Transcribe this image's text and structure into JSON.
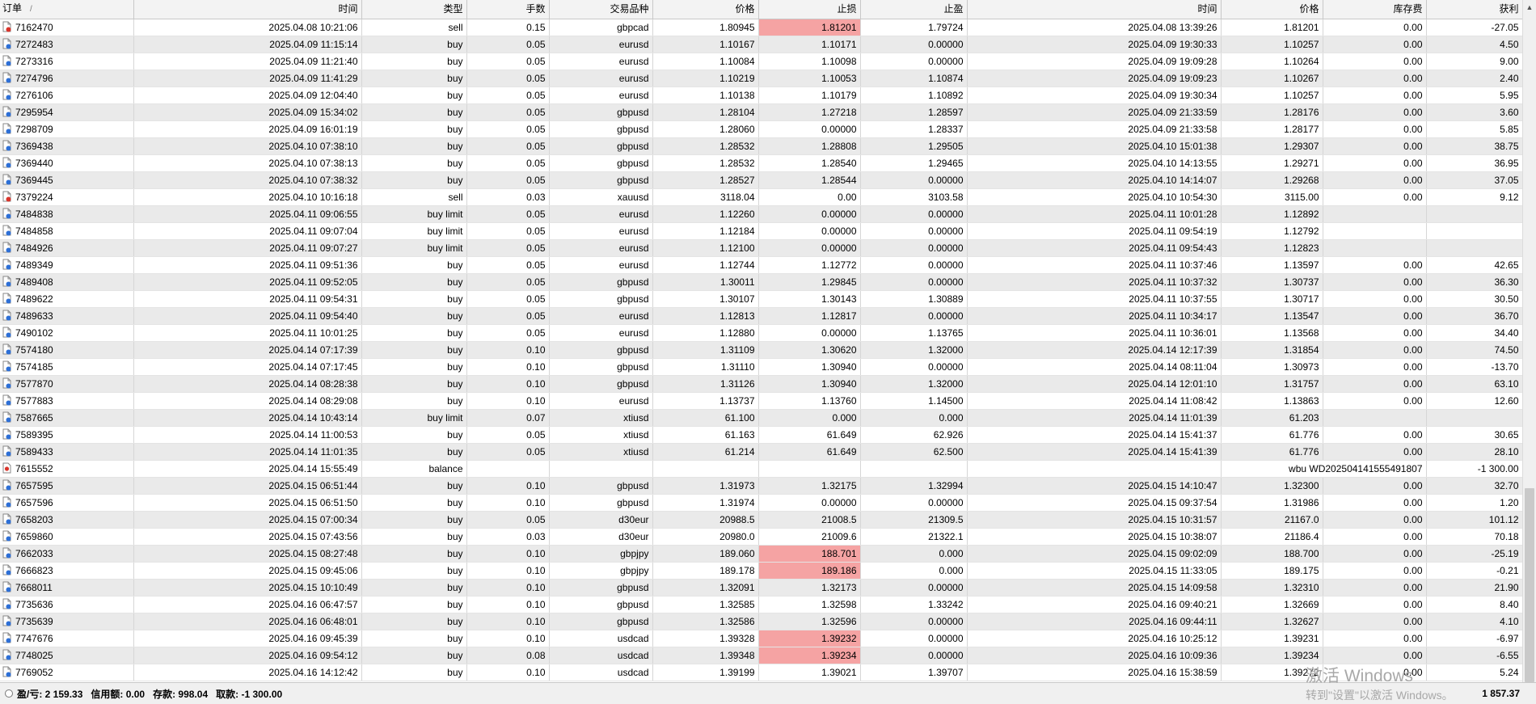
{
  "table": {
    "headers": [
      "订单",
      "时间",
      "类型",
      "手数",
      "交易品种",
      "价格",
      "止损",
      "止盈",
      "时间",
      "价格",
      "库存费",
      "获利"
    ],
    "sort_indicator": "/",
    "rows": [
      {
        "id": "7162470",
        "icon": "sell",
        "open_time": "2025.04.08 10:21:06",
        "type": "sell",
        "lots": "0.15",
        "symbol": "gbpcad",
        "price": "1.80945",
        "sl": "1.81201",
        "tp": "1.79724",
        "close_time": "2025.04.08 13:39:26",
        "close_price": "1.81201",
        "swap": "0.00",
        "profit": "-27.05",
        "sl_hit": true
      },
      {
        "id": "7272483",
        "icon": "buy",
        "open_time": "2025.04.09 11:15:14",
        "type": "buy",
        "lots": "0.05",
        "symbol": "eurusd",
        "price": "1.10167",
        "sl": "1.10171",
        "tp": "0.00000",
        "close_time": "2025.04.09 19:30:33",
        "close_price": "1.10257",
        "swap": "0.00",
        "profit": "4.50"
      },
      {
        "id": "7273316",
        "icon": "buy",
        "open_time": "2025.04.09 11:21:40",
        "type": "buy",
        "lots": "0.05",
        "symbol": "eurusd",
        "price": "1.10084",
        "sl": "1.10098",
        "tp": "0.00000",
        "close_time": "2025.04.09 19:09:28",
        "close_price": "1.10264",
        "swap": "0.00",
        "profit": "9.00"
      },
      {
        "id": "7274796",
        "icon": "buy",
        "open_time": "2025.04.09 11:41:29",
        "type": "buy",
        "lots": "0.05",
        "symbol": "eurusd",
        "price": "1.10219",
        "sl": "1.10053",
        "tp": "1.10874",
        "close_time": "2025.04.09 19:09:23",
        "close_price": "1.10267",
        "swap": "0.00",
        "profit": "2.40"
      },
      {
        "id": "7276106",
        "icon": "buy",
        "open_time": "2025.04.09 12:04:40",
        "type": "buy",
        "lots": "0.05",
        "symbol": "eurusd",
        "price": "1.10138",
        "sl": "1.10179",
        "tp": "1.10892",
        "close_time": "2025.04.09 19:30:34",
        "close_price": "1.10257",
        "swap": "0.00",
        "profit": "5.95"
      },
      {
        "id": "7295954",
        "icon": "buy",
        "open_time": "2025.04.09 15:34:02",
        "type": "buy",
        "lots": "0.05",
        "symbol": "gbpusd",
        "price": "1.28104",
        "sl": "1.27218",
        "tp": "1.28597",
        "close_time": "2025.04.09 21:33:59",
        "close_price": "1.28176",
        "swap": "0.00",
        "profit": "3.60"
      },
      {
        "id": "7298709",
        "icon": "buy",
        "open_time": "2025.04.09 16:01:19",
        "type": "buy",
        "lots": "0.05",
        "symbol": "gbpusd",
        "price": "1.28060",
        "sl": "0.00000",
        "tp": "1.28337",
        "close_time": "2025.04.09 21:33:58",
        "close_price": "1.28177",
        "swap": "0.00",
        "profit": "5.85"
      },
      {
        "id": "7369438",
        "icon": "buy",
        "open_time": "2025.04.10 07:38:10",
        "type": "buy",
        "lots": "0.05",
        "symbol": "gbpusd",
        "price": "1.28532",
        "sl": "1.28808",
        "tp": "1.29505",
        "close_time": "2025.04.10 15:01:38",
        "close_price": "1.29307",
        "swap": "0.00",
        "profit": "38.75"
      },
      {
        "id": "7369440",
        "icon": "buy",
        "open_time": "2025.04.10 07:38:13",
        "type": "buy",
        "lots": "0.05",
        "symbol": "gbpusd",
        "price": "1.28532",
        "sl": "1.28540",
        "tp": "1.29465",
        "close_time": "2025.04.10 14:13:55",
        "close_price": "1.29271",
        "swap": "0.00",
        "profit": "36.95"
      },
      {
        "id": "7369445",
        "icon": "buy",
        "open_time": "2025.04.10 07:38:32",
        "type": "buy",
        "lots": "0.05",
        "symbol": "gbpusd",
        "price": "1.28527",
        "sl": "1.28544",
        "tp": "0.00000",
        "close_time": "2025.04.10 14:14:07",
        "close_price": "1.29268",
        "swap": "0.00",
        "profit": "37.05"
      },
      {
        "id": "7379224",
        "icon": "sell",
        "open_time": "2025.04.10 10:16:18",
        "type": "sell",
        "lots": "0.03",
        "symbol": "xauusd",
        "price": "3118.04",
        "sl": "0.00",
        "tp": "3103.58",
        "close_time": "2025.04.10 10:54:30",
        "close_price": "3115.00",
        "swap": "0.00",
        "profit": "9.12"
      },
      {
        "id": "7484838",
        "icon": "buy",
        "open_time": "2025.04.11 09:06:55",
        "type": "buy limit",
        "lots": "0.05",
        "symbol": "eurusd",
        "price": "1.12260",
        "sl": "0.00000",
        "tp": "0.00000",
        "close_time": "2025.04.11 10:01:28",
        "close_price": "1.12892",
        "swap": "",
        "profit": ""
      },
      {
        "id": "7484858",
        "icon": "buy",
        "open_time": "2025.04.11 09:07:04",
        "type": "buy limit",
        "lots": "0.05",
        "symbol": "eurusd",
        "price": "1.12184",
        "sl": "0.00000",
        "tp": "0.00000",
        "close_time": "2025.04.11 09:54:19",
        "close_price": "1.12792",
        "swap": "",
        "profit": ""
      },
      {
        "id": "7484926",
        "icon": "buy",
        "open_time": "2025.04.11 09:07:27",
        "type": "buy limit",
        "lots": "0.05",
        "symbol": "eurusd",
        "price": "1.12100",
        "sl": "0.00000",
        "tp": "0.00000",
        "close_time": "2025.04.11 09:54:43",
        "close_price": "1.12823",
        "swap": "",
        "profit": ""
      },
      {
        "id": "7489349",
        "icon": "buy",
        "open_time": "2025.04.11 09:51:36",
        "type": "buy",
        "lots": "0.05",
        "symbol": "eurusd",
        "price": "1.12744",
        "sl": "1.12772",
        "tp": "0.00000",
        "close_time": "2025.04.11 10:37:46",
        "close_price": "1.13597",
        "swap": "0.00",
        "profit": "42.65"
      },
      {
        "id": "7489408",
        "icon": "buy",
        "open_time": "2025.04.11 09:52:05",
        "type": "buy",
        "lots": "0.05",
        "symbol": "gbpusd",
        "price": "1.30011",
        "sl": "1.29845",
        "tp": "0.00000",
        "close_time": "2025.04.11 10:37:32",
        "close_price": "1.30737",
        "swap": "0.00",
        "profit": "36.30"
      },
      {
        "id": "7489622",
        "icon": "buy",
        "open_time": "2025.04.11 09:54:31",
        "type": "buy",
        "lots": "0.05",
        "symbol": "gbpusd",
        "price": "1.30107",
        "sl": "1.30143",
        "tp": "1.30889",
        "close_time": "2025.04.11 10:37:55",
        "close_price": "1.30717",
        "swap": "0.00",
        "profit": "30.50"
      },
      {
        "id": "7489633",
        "icon": "buy",
        "open_time": "2025.04.11 09:54:40",
        "type": "buy",
        "lots": "0.05",
        "symbol": "eurusd",
        "price": "1.12813",
        "sl": "1.12817",
        "tp": "0.00000",
        "close_time": "2025.04.11 10:34:17",
        "close_price": "1.13547",
        "swap": "0.00",
        "profit": "36.70"
      },
      {
        "id": "7490102",
        "icon": "buy",
        "open_time": "2025.04.11 10:01:25",
        "type": "buy",
        "lots": "0.05",
        "symbol": "eurusd",
        "price": "1.12880",
        "sl": "0.00000",
        "tp": "1.13765",
        "close_time": "2025.04.11 10:36:01",
        "close_price": "1.13568",
        "swap": "0.00",
        "profit": "34.40"
      },
      {
        "id": "7574180",
        "icon": "buy",
        "open_time": "2025.04.14 07:17:39",
        "type": "buy",
        "lots": "0.10",
        "symbol": "gbpusd",
        "price": "1.31109",
        "sl": "1.30620",
        "tp": "1.32000",
        "close_time": "2025.04.14 12:17:39",
        "close_price": "1.31854",
        "swap": "0.00",
        "profit": "74.50"
      },
      {
        "id": "7574185",
        "icon": "buy",
        "open_time": "2025.04.14 07:17:45",
        "type": "buy",
        "lots": "0.10",
        "symbol": "gbpusd",
        "price": "1.31110",
        "sl": "1.30940",
        "tp": "0.00000",
        "close_time": "2025.04.14 08:11:04",
        "close_price": "1.30973",
        "swap": "0.00",
        "profit": "-13.70"
      },
      {
        "id": "7577870",
        "icon": "buy",
        "open_time": "2025.04.14 08:28:38",
        "type": "buy",
        "lots": "0.10",
        "symbol": "gbpusd",
        "price": "1.31126",
        "sl": "1.30940",
        "tp": "1.32000",
        "close_time": "2025.04.14 12:01:10",
        "close_price": "1.31757",
        "swap": "0.00",
        "profit": "63.10"
      },
      {
        "id": "7577883",
        "icon": "buy",
        "open_time": "2025.04.14 08:29:08",
        "type": "buy",
        "lots": "0.10",
        "symbol": "eurusd",
        "price": "1.13737",
        "sl": "1.13760",
        "tp": "1.14500",
        "close_time": "2025.04.14 11:08:42",
        "close_price": "1.13863",
        "swap": "0.00",
        "profit": "12.60"
      },
      {
        "id": "7587665",
        "icon": "buy",
        "open_time": "2025.04.14 10:43:14",
        "type": "buy limit",
        "lots": "0.07",
        "symbol": "xtiusd",
        "price": "61.100",
        "sl": "0.000",
        "tp": "0.000",
        "close_time": "2025.04.14 11:01:39",
        "close_price": "61.203",
        "swap": "",
        "profit": ""
      },
      {
        "id": "7589395",
        "icon": "buy",
        "open_time": "2025.04.14 11:00:53",
        "type": "buy",
        "lots": "0.05",
        "symbol": "xtiusd",
        "price": "61.163",
        "sl": "61.649",
        "tp": "62.926",
        "close_time": "2025.04.14 15:41:37",
        "close_price": "61.776",
        "swap": "0.00",
        "profit": "30.65"
      },
      {
        "id": "7589433",
        "icon": "buy",
        "open_time": "2025.04.14 11:01:35",
        "type": "buy",
        "lots": "0.05",
        "symbol": "xtiusd",
        "price": "61.214",
        "sl": "61.649",
        "tp": "62.500",
        "close_time": "2025.04.14 15:41:39",
        "close_price": "61.776",
        "swap": "0.00",
        "profit": "28.10"
      },
      {
        "id": "7615552",
        "icon": "balance",
        "open_time": "2025.04.14 15:55:49",
        "type": "balance",
        "lots": "",
        "symbol": "",
        "price": "",
        "sl": "",
        "tp": "",
        "close_time": "",
        "close_price": "",
        "swap": "wbu WD20250414155549180​7",
        "profit": "-1 300.00"
      },
      {
        "id": "7657595",
        "icon": "buy",
        "open_time": "2025.04.15 06:51:44",
        "type": "buy",
        "lots": "0.10",
        "symbol": "gbpusd",
        "price": "1.31973",
        "sl": "1.32175",
        "tp": "1.32994",
        "close_time": "2025.04.15 14:10:47",
        "close_price": "1.32300",
        "swap": "0.00",
        "profit": "32.70"
      },
      {
        "id": "7657596",
        "icon": "buy",
        "open_time": "2025.04.15 06:51:50",
        "type": "buy",
        "lots": "0.10",
        "symbol": "gbpusd",
        "price": "1.31974",
        "sl": "0.00000",
        "tp": "0.00000",
        "close_time": "2025.04.15 09:37:54",
        "close_price": "1.31986",
        "swap": "0.00",
        "profit": "1.20"
      },
      {
        "id": "7658203",
        "icon": "buy",
        "open_time": "2025.04.15 07:00:34",
        "type": "buy",
        "lots": "0.05",
        "symbol": "d30eur",
        "price": "20988.5",
        "sl": "21008.5",
        "tp": "21309.5",
        "close_time": "2025.04.15 10:31:57",
        "close_price": "21167.0",
        "swap": "0.00",
        "profit": "101.12"
      },
      {
        "id": "7659860",
        "icon": "buy",
        "open_time": "2025.04.15 07:43:56",
        "type": "buy",
        "lots": "0.03",
        "symbol": "d30eur",
        "price": "20980.0",
        "sl": "21009.6",
        "tp": "21322.1",
        "close_time": "2025.04.15 10:38:07",
        "close_price": "21186.4",
        "swap": "0.00",
        "profit": "70.18"
      },
      {
        "id": "7662033",
        "icon": "buy",
        "open_time": "2025.04.15 08:27:48",
        "type": "buy",
        "lots": "0.10",
        "symbol": "gbpjpy",
        "price": "189.060",
        "sl": "188.701",
        "tp": "0.000",
        "close_time": "2025.04.15 09:02:09",
        "close_price": "188.700",
        "swap": "0.00",
        "profit": "-25.19",
        "sl_hit": true
      },
      {
        "id": "7666823",
        "icon": "buy",
        "open_time": "2025.04.15 09:45:06",
        "type": "buy",
        "lots": "0.10",
        "symbol": "gbpjpy",
        "price": "189.178",
        "sl": "189.186",
        "tp": "0.000",
        "close_time": "2025.04.15 11:33:05",
        "close_price": "189.175",
        "swap": "0.00",
        "profit": "-0.21",
        "sl_hit": true
      },
      {
        "id": "7668011",
        "icon": "buy",
        "open_time": "2025.04.15 10:10:49",
        "type": "buy",
        "lots": "0.10",
        "symbol": "gbpusd",
        "price": "1.32091",
        "sl": "1.32173",
        "tp": "0.00000",
        "close_time": "2025.04.15 14:09:58",
        "close_price": "1.32310",
        "swap": "0.00",
        "profit": "21.90"
      },
      {
        "id": "7735636",
        "icon": "buy",
        "open_time": "2025.04.16 06:47:57",
        "type": "buy",
        "lots": "0.10",
        "symbol": "gbpusd",
        "price": "1.32585",
        "sl": "1.32598",
        "tp": "1.33242",
        "close_time": "2025.04.16 09:40:21",
        "close_price": "1.32669",
        "swap": "0.00",
        "profit": "8.40"
      },
      {
        "id": "7735639",
        "icon": "buy",
        "open_time": "2025.04.16 06:48:01",
        "type": "buy",
        "lots": "0.10",
        "symbol": "gbpusd",
        "price": "1.32586",
        "sl": "1.32596",
        "tp": "0.00000",
        "close_time": "2025.04.16 09:44:11",
        "close_price": "1.32627",
        "swap": "0.00",
        "profit": "4.10"
      },
      {
        "id": "7747676",
        "icon": "buy",
        "open_time": "2025.04.16 09:45:39",
        "type": "buy",
        "lots": "0.10",
        "symbol": "usdcad",
        "price": "1.39328",
        "sl": "1.39232",
        "tp": "0.00000",
        "close_time": "2025.04.16 10:25:12",
        "close_price": "1.39231",
        "swap": "0.00",
        "profit": "-6.97",
        "sl_hit": true
      },
      {
        "id": "7748025",
        "icon": "buy",
        "open_time": "2025.04.16 09:54:12",
        "type": "buy",
        "lots": "0.08",
        "symbol": "usdcad",
        "price": "1.39348",
        "sl": "1.39234",
        "tp": "0.00000",
        "close_time": "2025.04.16 10:09:36",
        "close_price": "1.39234",
        "swap": "0.00",
        "profit": "-6.55",
        "sl_hit": true
      },
      {
        "id": "7769052",
        "icon": "buy",
        "open_time": "2025.04.16 14:12:42",
        "type": "buy",
        "lots": "0.10",
        "symbol": "usdcad",
        "price": "1.39199",
        "sl": "1.39021",
        "tp": "1.39707",
        "close_time": "2025.04.16 15:38:59",
        "close_price": "1.39272",
        "swap": "0.00",
        "profit": "5.24"
      }
    ]
  },
  "status_bar": {
    "pnl": "盈/亏: 2 159.33",
    "credit": "信用额: 0.00",
    "deposit": "存款: 998.04",
    "withdrawal": "取款: -1 300.00",
    "total": "1 857.37"
  },
  "watermark": {
    "title": "激活 Windows",
    "subtitle": "转到\"设置\"以激活 Windows。"
  },
  "colors": {
    "sl_highlight": "#f5a3a3",
    "row_alt": "#eaeaea",
    "sell_icon": "#d9342b",
    "buy_icon": "#2d6fd6"
  }
}
